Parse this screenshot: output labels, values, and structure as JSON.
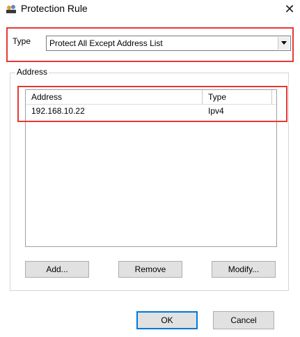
{
  "window": {
    "title": "Protection Rule",
    "icon": "shield-users-icon"
  },
  "type_selector": {
    "label": "Type",
    "selected": "Protect All Except Address List"
  },
  "address_group": {
    "label": "Address",
    "columns": [
      "Address",
      "Type"
    ],
    "rows": [
      {
        "address": "192.168.10.22",
        "type": "Ipv4"
      }
    ],
    "buttons": {
      "add": "Add...",
      "remove": "Remove",
      "modify": "Modify..."
    }
  },
  "dialog_buttons": {
    "ok": "OK",
    "cancel": "Cancel"
  },
  "highlight_color": "#e53935"
}
